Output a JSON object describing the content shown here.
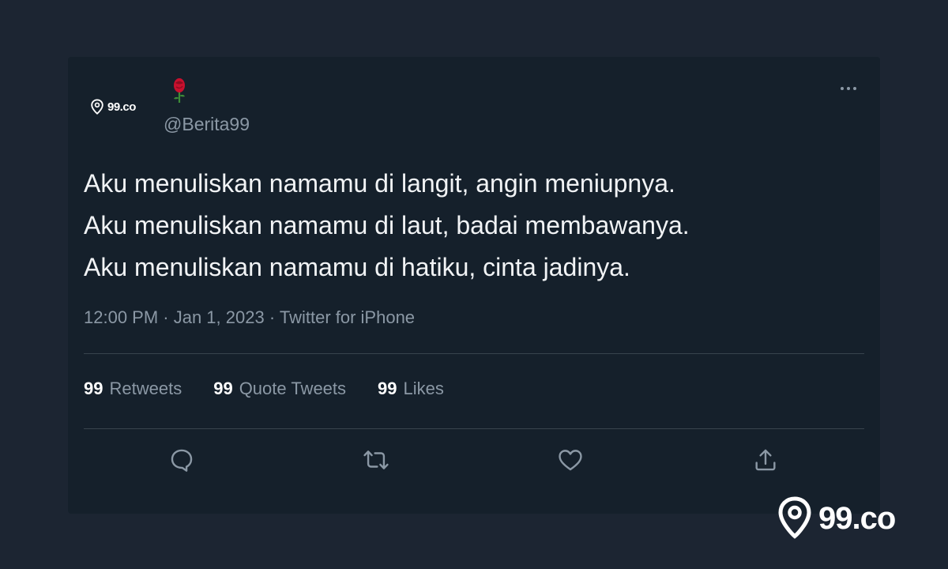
{
  "tweet": {
    "avatar_brand": "99.co",
    "handle": "@Berita99",
    "text_lines": [
      "Aku menuliskan namamu di langit, angin meniupnya.",
      "Aku menuliskan namamu di laut, badai membawanya.",
      "Aku menuliskan namamu di hatiku, cinta jadinya."
    ],
    "meta": "12:00 PM · Jan 1, 2023 · Twitter for iPhone",
    "stats": [
      {
        "count": "99",
        "label": "Retweets"
      },
      {
        "count": "99",
        "label": "Quote Tweets"
      },
      {
        "count": "99",
        "label": "Likes"
      }
    ],
    "icons": {
      "more": "more-horizontal-icon",
      "reply": "reply-icon",
      "retweet": "retweet-icon",
      "like": "heart-icon",
      "share": "share-icon",
      "name_emoji": "rose-icon"
    }
  },
  "watermark": {
    "brand": "99.co"
  },
  "colors": {
    "page_bg": "#1c2532",
    "card_bg": "#15202b",
    "text": "#f1f3f5",
    "muted": "#8b98a5",
    "divider": "#38444d"
  }
}
